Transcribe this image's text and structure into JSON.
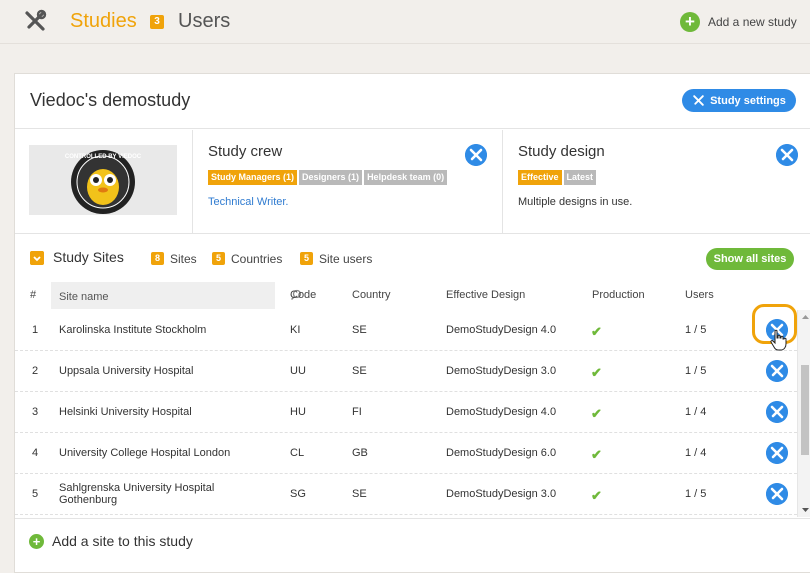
{
  "nav": {
    "studies_label": "Studies",
    "studies_count": "3",
    "users_label": "Users",
    "add_study_label": "Add a new study"
  },
  "study": {
    "title": "Viedoc's demostudy",
    "settings_label": "Study settings",
    "logo_text": "CONTROLLED BY VIEDOC"
  },
  "crew": {
    "title": "Study crew",
    "tags": [
      "Study Managers (1)",
      "Designers (1)",
      "Helpdesk team (0)"
    ],
    "link": "Technical Writer."
  },
  "design": {
    "title": "Study design",
    "tags": [
      "Effective",
      "Latest"
    ],
    "text": "Multiple designs in use."
  },
  "sites": {
    "title": "Study Sites",
    "counts": [
      {
        "n": "8",
        "label": "Sites"
      },
      {
        "n": "5",
        "label": "Countries"
      },
      {
        "n": "5",
        "label": "Site users"
      }
    ],
    "show_all_label": "Show all sites",
    "add_label": "Add a site to this study"
  },
  "table": {
    "headers": [
      "#",
      "Site name",
      "Code",
      "Country",
      "Effective Design",
      "Production",
      "Users"
    ],
    "rows": [
      {
        "n": "1",
        "name": "Karolinska Institute Stockholm",
        "code": "KI",
        "country": "SE",
        "design": "DemoStudyDesign 4.0",
        "users": "1 / 5"
      },
      {
        "n": "2",
        "name": "Uppsala University Hospital",
        "code": "UU",
        "country": "SE",
        "design": "DemoStudyDesign 3.0",
        "users": "1 / 5"
      },
      {
        "n": "3",
        "name": "Helsinki University Hospital",
        "code": "HU",
        "country": "FI",
        "design": "DemoStudyDesign 4.0",
        "users": "1 / 4"
      },
      {
        "n": "4",
        "name": "University College Hospital London",
        "code": "CL",
        "country": "GB",
        "design": "DemoStudyDesign 6.0",
        "users": "1 / 4"
      },
      {
        "n": "5",
        "name": "Sahlgrenska University Hospital Gothenburg",
        "code": "SG",
        "country": "SE",
        "design": "DemoStudyDesign 3.0",
        "users": "1 / 5"
      }
    ]
  },
  "colors": {
    "accent_orange": "#f0a30a",
    "accent_blue": "#2f8be6",
    "accent_green": "#6fb93a"
  }
}
